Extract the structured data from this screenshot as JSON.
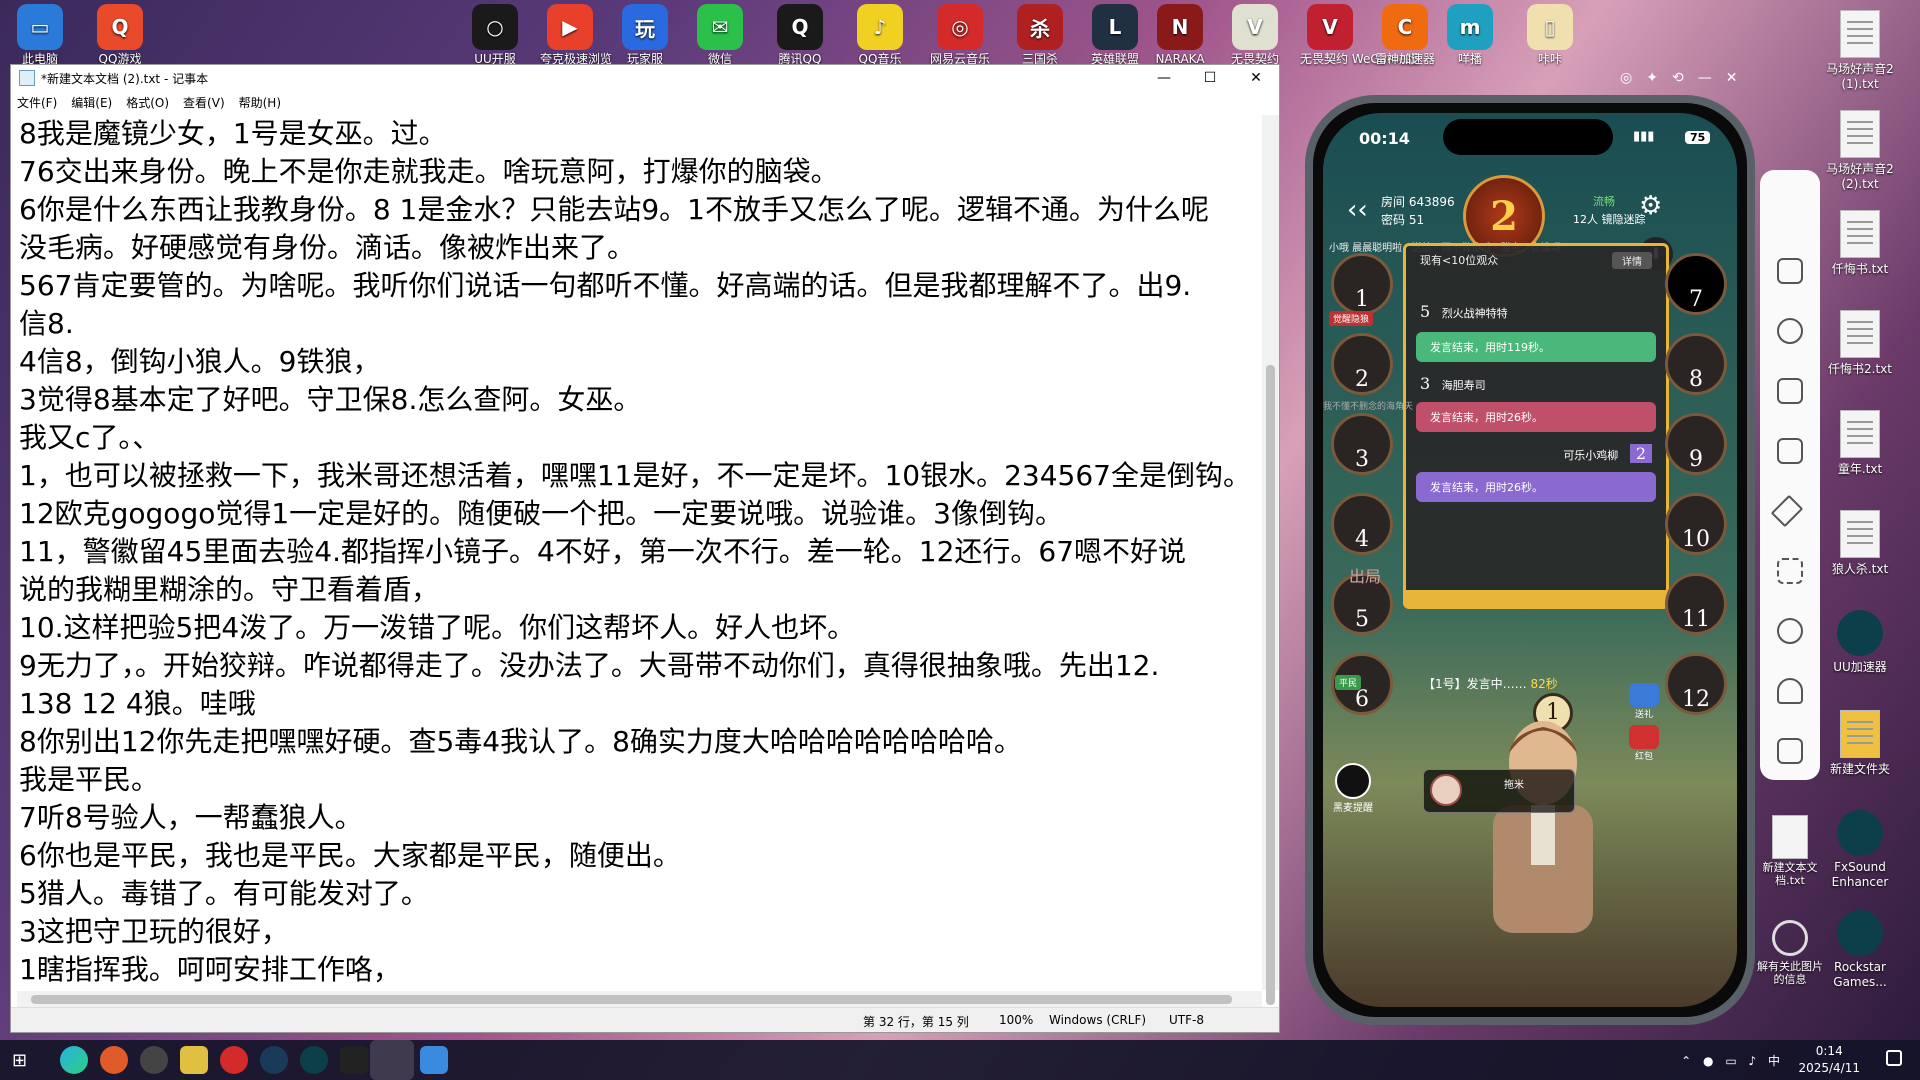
{
  "desktop_top_icons": [
    {
      "label": "此电脑",
      "color": "#2a7ad9",
      "glyph": "▭"
    },
    {
      "label": "QQ游戏",
      "color": "#e84a2a",
      "glyph": "Q"
    },
    {
      "label": "UU开服",
      "color": "#1a1a1a",
      "glyph": "○"
    },
    {
      "label": "夸克极速浏览",
      "color": "#e8402a",
      "glyph": "▶"
    },
    {
      "label": "玩家服",
      "color": "#2a6ae0",
      "glyph": "玩"
    },
    {
      "label": "微信",
      "color": "#2ac04a",
      "glyph": "✉"
    },
    {
      "label": "腾讯QQ",
      "color": "#1a1a1a",
      "glyph": "Q"
    },
    {
      "label": "QQ音乐",
      "color": "#f0d020",
      "glyph": "♪"
    },
    {
      "label": "网易云音乐",
      "color": "#d42a2a",
      "glyph": "◎"
    },
    {
      "label": "三国杀",
      "color": "#b02020",
      "glyph": "杀"
    },
    {
      "label": "英雄联盟",
      "color": "#203040",
      "glyph": "L"
    },
    {
      "label": "NARAKA",
      "color": "#8a1a1a",
      "glyph": "N"
    },
    {
      "label": "无畏契约",
      "color": "#e0e0d0",
      "glyph": "V"
    },
    {
      "label": "无畏契约 WeGame版",
      "color": "#c02030",
      "glyph": "V"
    },
    {
      "label": "雷神加速器",
      "color": "#f06a10",
      "glyph": "C"
    },
    {
      "label": "咩播",
      "color": "#20a0c0",
      "glyph": "m"
    },
    {
      "label": "咔咔",
      "color": "#f0e0b0",
      "glyph": "▯"
    }
  ],
  "desktop_right_icons": [
    {
      "label": "马场好声音2 (1).txt",
      "type": "file"
    },
    {
      "label": "马场好声音2 (2).txt",
      "type": "file"
    },
    {
      "label": "仟悔书.txt",
      "type": "file"
    },
    {
      "label": "仟悔书2.txt",
      "type": "file"
    },
    {
      "label": "童年.txt",
      "type": "file"
    },
    {
      "label": "狼人杀.txt",
      "type": "file"
    },
    {
      "label": "UU加速器",
      "type": "app"
    },
    {
      "label": "新建文件夹",
      "type": "folder"
    },
    {
      "label": "FxSound Enhancer",
      "type": "app"
    },
    {
      "label": "Rockstar Games...",
      "type": "app"
    }
  ],
  "desktop_mid_icons": [
    {
      "label": "新建文本文档.txt"
    },
    {
      "label": "解有关此图片的信息"
    }
  ],
  "notepad": {
    "title": "*新建文本文档 (2).txt - 记事本",
    "menu": [
      "文件(F)",
      "编辑(E)",
      "格式(O)",
      "查看(V)",
      "帮助(H)"
    ],
    "lines": [
      "8我是魔镜少女，1号是女巫。过。",
      "76交出来身份。晚上不是你走就我走。啥玩意阿，打爆你的脑袋。",
      "6你是什么东西让我教身份。8 1是金水？只能去站9。1不放手又怎么了呢。逻辑不通。为什么呢",
      "没毛病。好硬感觉有身份。滴话。像被炸出来了。",
      "567肯定要管的。为啥呢。我听你们说话一句都听不懂。好高端的话。但是我都理解不了。出9.",
      "信8.",
      "4信8，倒钩小狼人。9铁狼，",
      "3觉得8基本定了好吧。守卫保8.怎么查阿。女巫。",
      "我又c了。、",
      "1，也可以被拯救一下，我米哥还想活着，嘿嘿11是好，不一定是坏。10银水。234567全是倒钩。",
      "12欧克gogogo觉得1一定是好的。随便破一个把。一定要说哦。说验谁。3像倒钩。",
      "11，警徽留45里面去验4.都指挥小镜子。4不好，第一次不行。差一轮。12还行。67嗯不好说",
      "说的我糊里糊涂的。守卫看着盾，",
      "10.这样把验5把4泼了。万一泼错了呢。你们这帮坏人。好人也坏。",
      "9无力了，。开始狡辩。咋说都得走了。没办法了。大哥带不动你们，真得很抽象哦。先出12.",
      "138 12 4狼。哇哦",
      "8你别出12你先走把嘿嘿好硬。查5毒4我认了。8确实力度大哈哈哈哈哈哈哈哈。",
      "我是平民。",
      "7听8号验人，一帮蠢狼人。",
      "6你也是平民，我也是平民。大家都是平民，随便出。",
      "5猎人。毒错了。有可能发对了。",
      "3这把守卫玩的很好，",
      "1瞎指挥我。呵呵安排工作咯，"
    ],
    "status": {
      "position": "第 32 行，第 15 列",
      "zoom": "100%",
      "eol": "Windows (CRLF)",
      "encoding": "UTF-8"
    }
  },
  "phone": {
    "time": "00:14",
    "battery": "75",
    "room_id": "房间 643896",
    "password": "密码 51",
    "day": "第 2 天",
    "day_number": "2",
    "network": "流畅",
    "players_hidden": "12人 镜隐迷踪",
    "viewers": "现有<10位观众",
    "detail_btn": "详情",
    "chat": [
      {
        "player": "5",
        "name": "烈火战神特特",
        "msg": "发言结束，用时119秒。",
        "color": "#4ab87a"
      },
      {
        "player": "3",
        "name": "海胆寿司",
        "msg": "发言结束，用时26秒。",
        "color": "#c0506a"
      },
      {
        "player": "2",
        "name": "可乐小鸡柳",
        "msg": "发言结束，用时26秒。",
        "color": "#8a6ad0"
      }
    ],
    "speaking": "【1号】发言中……",
    "speaking_time": "82秒",
    "current_speaker": "1",
    "left_seats": [
      "1",
      "2",
      "3",
      "4",
      "5",
      "6"
    ],
    "right_seats": [
      "7",
      "8",
      "9",
      "10",
      "11",
      "12"
    ],
    "badge_left_2": "觉醒隐狼",
    "badge_left_6": "平民",
    "badge_out": "出局",
    "mic_label": "黑麦提醒",
    "bottom_name": "拖米",
    "gift_label": "送礼",
    "redpacket_label": "红包",
    "marquee": "小哦 晨晨聪明啦 · 送给 · 再不做傻瓜 · 赠言：你谁呀",
    "left_note": "我不懂不删念的海角天涯"
  },
  "taskbar": {
    "time": "0:14",
    "date": "2025/4/11",
    "lang": "中"
  }
}
